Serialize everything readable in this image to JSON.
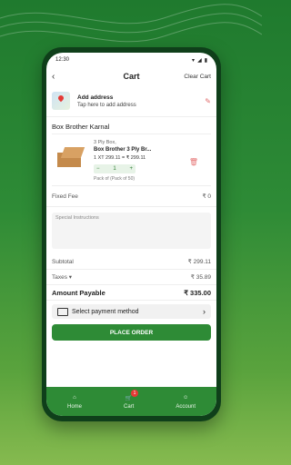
{
  "status_bar": {
    "time": "12:30"
  },
  "header": {
    "title": "Cart",
    "clear_label": "Clear Cart"
  },
  "address": {
    "title": "Add address",
    "subtitle": "Tap here to add address"
  },
  "store": {
    "name": "Box Brother Karnal"
  },
  "cart_items": [
    {
      "category": "3 Ply Box,",
      "name": "Box Brother 3 Ply Br...",
      "price_line": "1 XT 299.11 = ₹ 299.11",
      "quantity": "1",
      "pack": "Pack of (Pack of 50)"
    }
  ],
  "fees": {
    "fixed_label": "Fixed Fee",
    "fixed_value": "₹ 0"
  },
  "instructions": {
    "placeholder": "Special Instructions"
  },
  "summary": {
    "subtotal_label": "Subtotal",
    "subtotal_value": "₹ 299.11",
    "taxes_label": "Taxes",
    "taxes_value": "₹ 35.89",
    "payable_label": "Amount Payable",
    "payable_value": "₹ 335.00"
  },
  "payment": {
    "label": "Select payment method"
  },
  "actions": {
    "place_order": "PLACE ORDER"
  },
  "tabs": [
    {
      "label": "Home",
      "icon": "home-icon"
    },
    {
      "label": "Cart",
      "icon": "cart-icon",
      "badge": "1"
    },
    {
      "label": "Account",
      "icon": "account-icon"
    }
  ],
  "colors": {
    "brand": "#2e8b36",
    "danger": "#e53935",
    "background": "#1f7a2e"
  }
}
